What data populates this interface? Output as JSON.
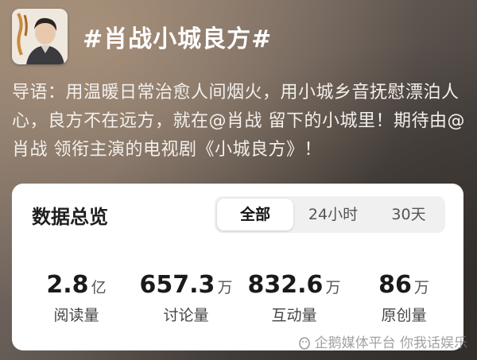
{
  "topic": {
    "title": "#肖战小城良方#"
  },
  "intro": {
    "text": "导语：用温暖日常治愈人间烟火，用小城乡音抚慰漂泊人心，良方不在远方，就在@肖战 留下的小城里！期待由@肖战 领衔主演的电视剧《小城良方》！"
  },
  "overview": {
    "title": "数据总览",
    "tabs": [
      {
        "label": "全部",
        "active": true
      },
      {
        "label": "24小时",
        "active": false
      },
      {
        "label": "30天",
        "active": false
      }
    ],
    "stats": [
      {
        "value": "2.8",
        "unit": "亿",
        "label": "阅读量"
      },
      {
        "value": "657.3",
        "unit": "万",
        "label": "讨论量"
      },
      {
        "value": "832.6",
        "unit": "万",
        "label": "互动量"
      },
      {
        "value": "86",
        "unit": "万",
        "label": "原创量"
      }
    ]
  },
  "watermark": {
    "text": "企鹅媒体平台 你我话娱乐",
    "icon": "penguin-icon"
  },
  "colors": {
    "card_bg": "#ffffff",
    "tab_track": "#f0f0f0",
    "title_text": "#ffffff"
  }
}
